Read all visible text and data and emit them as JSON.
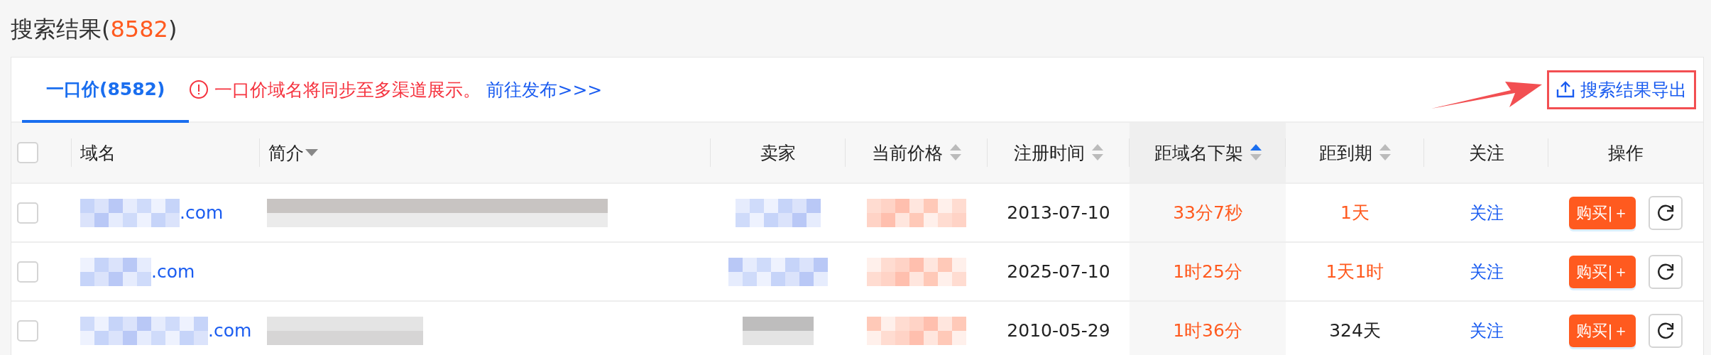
{
  "heading": {
    "title": "搜索结果(",
    "count": "8582",
    "suffix": ")"
  },
  "tabs": [
    {
      "label": "一口价(8582)",
      "selected": true
    }
  ],
  "notice": {
    "text": "一口价域名将同步至多渠道展示。",
    "link": "前往发布>>>"
  },
  "export": {
    "label": "搜索结果导出",
    "highlighted": true
  },
  "table": {
    "select_all": {
      "checked": false
    },
    "columns": [
      {
        "label": "域名",
        "kind": "plain"
      },
      {
        "label": "简介",
        "kind": "dropdown"
      },
      {
        "label": "卖家",
        "kind": "plain"
      },
      {
        "label": "当前价格",
        "kind": "sortable",
        "sorted_ascending": false
      },
      {
        "label": "注册时间",
        "kind": "sortable",
        "sorted_ascending": false
      },
      {
        "label": "距域名下架",
        "kind": "sortable",
        "sorted_ascending": true
      },
      {
        "label": "距到期",
        "kind": "sortable",
        "sorted_ascending": false
      },
      {
        "label": "关注",
        "kind": "plain"
      },
      {
        "label": "操作",
        "kind": "plain"
      }
    ],
    "rows": [
      {
        "checked": false,
        "domain": ".com",
        "intro_masked": true,
        "seller_masked": true,
        "price_masked": true,
        "registered": "2013-07-10",
        "delisting": "33分7秒",
        "expiry": "1天",
        "expiry_urgent": true,
        "follow": "关注",
        "buy": "购买|＋"
      },
      {
        "checked": false,
        "domain": ".com",
        "intro_masked": false,
        "seller_masked": true,
        "price_masked": true,
        "registered": "2025-07-10",
        "delisting": "1时25分",
        "expiry": "1天1时",
        "expiry_urgent": true,
        "follow": "关注",
        "buy": "购买|＋"
      },
      {
        "checked": false,
        "domain": ".com",
        "intro_masked": true,
        "seller_masked": true,
        "price_masked": true,
        "registered": "2010-05-29",
        "delisting": "1时36分",
        "expiry": "324天",
        "expiry_urgent": false,
        "follow": "关注",
        "buy": "购买|＋"
      }
    ]
  }
}
